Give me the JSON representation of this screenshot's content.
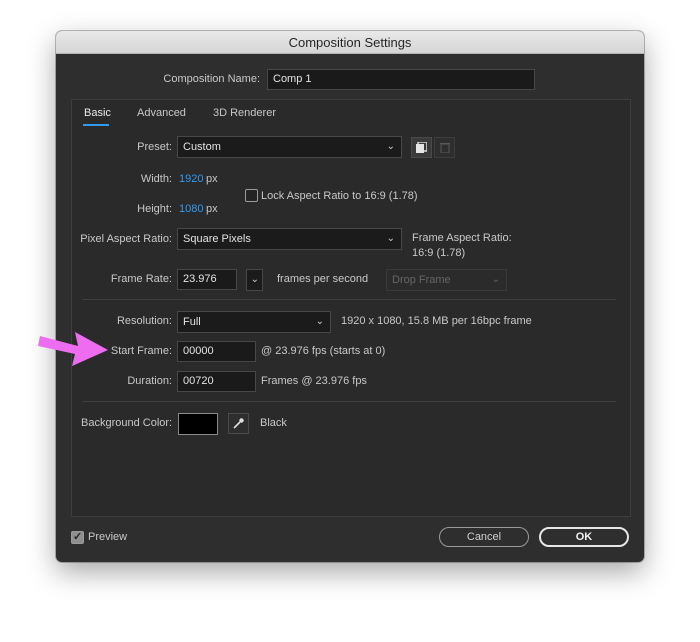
{
  "window": {
    "title": "Composition Settings"
  },
  "comp_name": {
    "label": "Composition Name:",
    "value": "Comp 1"
  },
  "tabs": [
    {
      "label": "Basic",
      "active": true
    },
    {
      "label": "Advanced",
      "active": false
    },
    {
      "label": "3D Renderer",
      "active": false
    }
  ],
  "preset": {
    "label": "Preset:",
    "value": "Custom"
  },
  "width": {
    "label": "Width:",
    "value": "1920",
    "unit": "px"
  },
  "height": {
    "label": "Height:",
    "value": "1080",
    "unit": "px"
  },
  "lock_aspect": {
    "label": "Lock Aspect Ratio to 16:9 (1.78)",
    "checked": false
  },
  "pixel_aspect": {
    "label": "Pixel Aspect Ratio:",
    "value": "Square Pixels"
  },
  "frame_aspect": {
    "label": "Frame Aspect Ratio:",
    "value": "16:9 (1.78)"
  },
  "frame_rate": {
    "label": "Frame Rate:",
    "value": "23.976",
    "suffix": "frames per second",
    "drop_frame": "Drop Frame"
  },
  "resolution": {
    "label": "Resolution:",
    "value": "Full",
    "info": "1920 x 1080, 15.8 MB per 16bpc frame"
  },
  "start_frame": {
    "label": "Start Frame:",
    "value": "00000",
    "info": "@ 23.976 fps (starts at 0)"
  },
  "duration": {
    "label": "Duration:",
    "value": "00720",
    "info": "Frames @ 23.976 fps"
  },
  "background": {
    "label": "Background Color:",
    "color_name": "Black",
    "color": "#000000"
  },
  "preview": {
    "label": "Preview",
    "checked": true
  },
  "buttons": {
    "cancel": "Cancel",
    "ok": "OK"
  },
  "annotation": {
    "arrow_color": "#ee6cf0"
  },
  "icons": {
    "dropdown": "chevron-down-icon",
    "save_preset": "save-preset-icon",
    "delete_preset": "trash-icon",
    "eyedropper": "eyedropper-icon"
  }
}
